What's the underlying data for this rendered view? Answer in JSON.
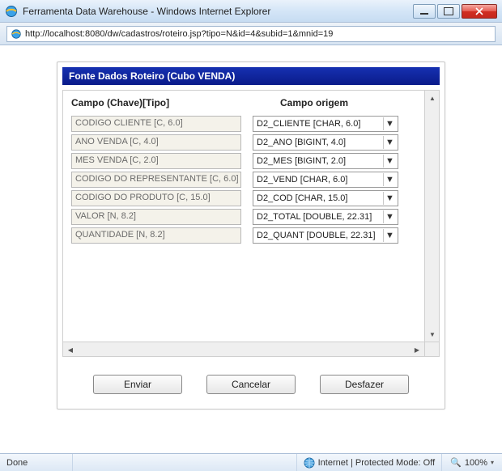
{
  "window": {
    "title": "Ferramenta Data Warehouse - Windows Internet Explorer",
    "url": "http://localhost:8080/dw/cadastros/roteiro.jsp?tipo=N&id=4&subid=1&mnid=19"
  },
  "dialog": {
    "title": "Fonte Dados Roteiro (Cubo VENDA)",
    "col1_label": "Campo (Chave)[Tipo]",
    "col2_label": "Campo origem",
    "rows": [
      {
        "field": "CODIGO CLIENTE [C, 6.0]",
        "origin": "D2_CLIENTE [CHAR, 6.0]"
      },
      {
        "field": "ANO VENDA [C, 4.0]",
        "origin": "D2_ANO [BIGINT, 4.0]"
      },
      {
        "field": "MES VENDA [C, 2.0]",
        "origin": "D2_MES [BIGINT, 2.0]"
      },
      {
        "field": "CODIGO DO REPRESENTANTE [C, 6.0]",
        "origin": "D2_VEND [CHAR, 6.0]"
      },
      {
        "field": "CODIGO DO PRODUTO [C, 15.0]",
        "origin": "D2_COD [CHAR, 15.0]"
      },
      {
        "field": "VALOR [N, 8.2]",
        "origin": "D2_TOTAL [DOUBLE, 22.31]"
      },
      {
        "field": "QUANTIDADE [N, 8.2]",
        "origin": "D2_QUANT [DOUBLE, 22.31]"
      }
    ],
    "buttons": {
      "submit": "Enviar",
      "cancel": "Cancelar",
      "undo": "Desfazer"
    }
  },
  "status": {
    "left": "Done",
    "zone": "Internet | Protected Mode: Off",
    "zoom": "100%"
  }
}
